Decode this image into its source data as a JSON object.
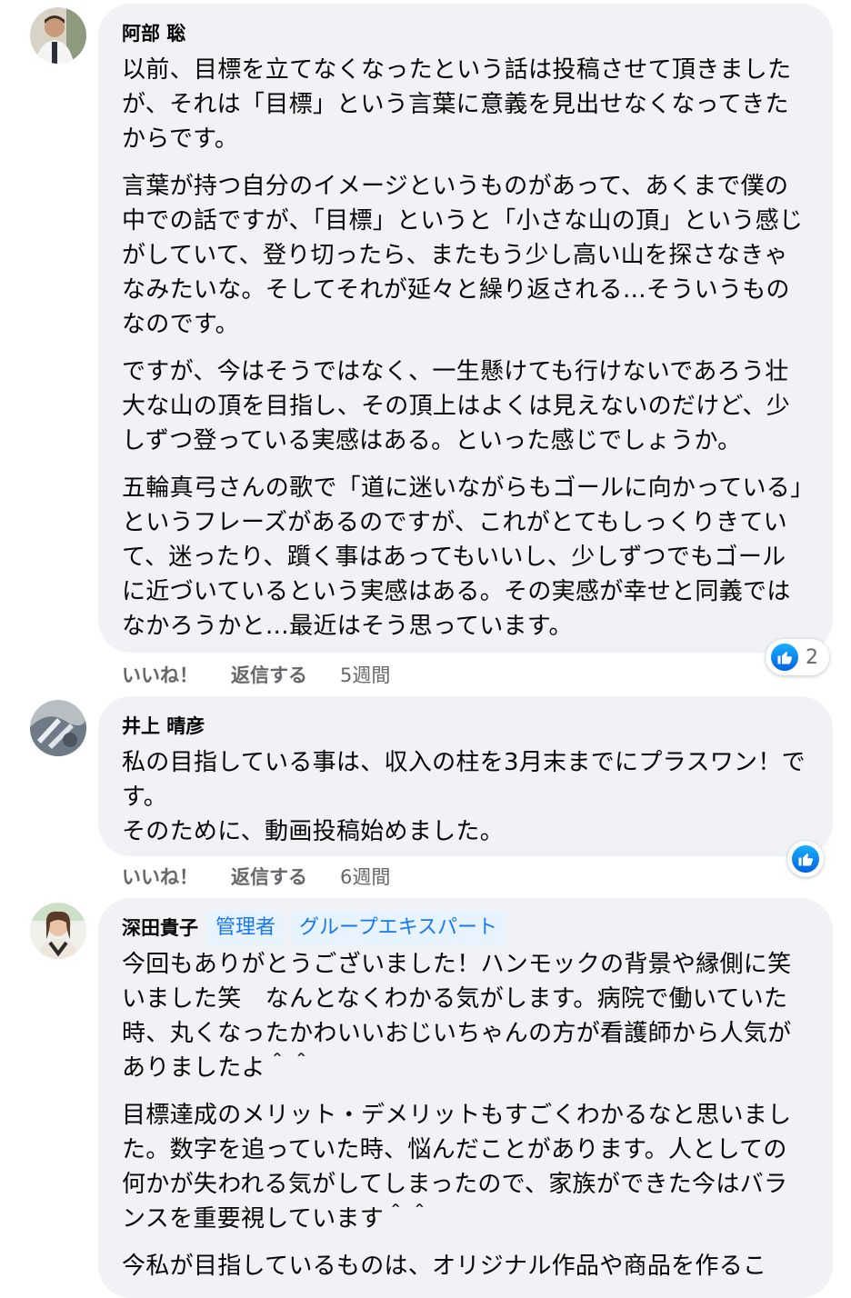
{
  "comments": [
    {
      "author": "阿部 聡",
      "paragraphs": [
        "以前、目標を立てなくなったという話は投稿させて頂きましたが、それは「目標」という言葉に意義を見出せなくなってきたからです。",
        "言葉が持つ自分のイメージというものがあって、あくまで僕の中での話ですが、「目標」というと「小さな山の頂」という感じがしていて、登り切ったら、またもう少し高い山を探さなきゃなみたいな。そしてそれが延々と繰り返される…そういうものなのです。",
        "ですが、今はそうではなく、一生懸けても行けないであろう壮大な山の頂を目指し、その頂上はよくは見えないのだけど、少しずつ登っている実感はある。といった感じでしょうか。",
        "五輪真弓さんの歌で「道に迷いながらもゴールに向かっている」というフレーズがあるのですが、これがとてもしっくりきていて、迷ったり、躓く事はあってもいいし、少しずつでもゴールに近づいているという実感はある。その実感が幸せと同義ではなかろうかと…最近はそう思っています。"
      ],
      "like_label": "いいね！",
      "reply_label": "返信する",
      "time": "5週間",
      "reaction_count": "2"
    },
    {
      "author": "井上 晴彦",
      "paragraphs": [
        "私の目指している事は、収入の柱を3月末までにプラスワン！です。\nそのために、動画投稿始めました。"
      ],
      "like_label": "いいね！",
      "reply_label": "返信する",
      "time": "6週間"
    },
    {
      "author": "深田貴子",
      "badges": [
        "管理者",
        "グループエキスパート"
      ],
      "paragraphs": [
        "今回もありがとうございました！ハンモックの背景や縁側に笑いました笑　なんとなくわかる気がします。病院で働いていた時、丸くなったかわいいおじいちゃんの方が看護師から人気がありましたよ＾＾",
        "目標達成のメリット・デメリットもすごくわかるなと思いました。数字を追っていた時、悩んだことがあります。人としての何かが失われる気がしてしまったので、家族ができた今はバランスを重要視しています＾＾",
        "今私が目指しているものは、オリジナル作品や商品を作るこ"
      ]
    }
  ],
  "colors": {
    "bubble": "#f0f2f5",
    "accent": "#1877f2",
    "meta_text": "#65676b"
  },
  "icons": [
    "like-icon"
  ]
}
